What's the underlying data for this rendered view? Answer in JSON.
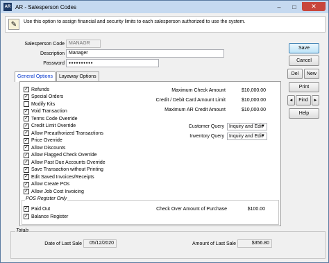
{
  "window": {
    "app_icon_text": "AR",
    "title": "AR - Salesperson Codes",
    "min": "–",
    "max": "□",
    "close": "✕"
  },
  "info": {
    "text": "Use this option to assign financial and security limits to each salesperson authorized  to use the system.",
    "icon": "info-icon"
  },
  "form": {
    "code_label": "Salesperson Code",
    "code_value": "MANAGR",
    "desc_label": "Description",
    "desc_value": "Manager",
    "pwd_label": "Password",
    "pwd_value": "●●●●●●●●●●"
  },
  "tabs": [
    "General Options",
    "Layaway Options"
  ],
  "options": [
    {
      "label": "Refunds",
      "checked": true
    },
    {
      "label": "Special Orders",
      "checked": true
    },
    {
      "label": "Modify Kits",
      "checked": false
    },
    {
      "label": "Void Transaction",
      "checked": true
    },
    {
      "label": "Terms Code Override",
      "checked": true
    },
    {
      "label": "Credit Limit Override",
      "checked": true
    },
    {
      "label": "Allow Preauthorized Transactions",
      "checked": true
    },
    {
      "label": "Price Override",
      "checked": true
    },
    {
      "label": "Allow Discounts",
      "checked": true
    },
    {
      "label": "Allow Flagged Check Override",
      "checked": true
    },
    {
      "label": "Allow Past Due Accounts Override",
      "checked": true
    },
    {
      "label": "Save Transaction without Printing",
      "checked": true
    },
    {
      "label": "Edit Saved Invoices/Receipts",
      "checked": true
    },
    {
      "label": "Allow Create POs",
      "checked": true
    },
    {
      "label": "Allow Job Cost Invoicing",
      "checked": true
    }
  ],
  "limits": [
    {
      "label": "Maximum Check Amount",
      "value": "$10,000.00"
    },
    {
      "label": "Credit / Debit Card Amount Limit",
      "value": "$10,000.00"
    },
    {
      "label": "Maximum AR Credit Amount",
      "value": "$10,000.00"
    }
  ],
  "queries": [
    {
      "label": "Customer Query",
      "value": "Inquiry and Edit"
    },
    {
      "label": "Inventory Query",
      "value": "Inquiry and Edit"
    }
  ],
  "pos": {
    "title": "POS Register Only",
    "options": [
      {
        "label": "Paid Out",
        "checked": true
      },
      {
        "label": "Balance Register",
        "checked": true
      }
    ],
    "over_label": "Check Over Amount of Purchase",
    "over_value": "$100.00"
  },
  "buttons": {
    "save": "Save",
    "cancel": "Cancel",
    "del": "Del",
    "new": "New",
    "print": "Print",
    "prev": "◄",
    "find": "Find",
    "next": "►",
    "help": "Help"
  },
  "totals": {
    "title": "Totals",
    "date_label": "Date of Last Sale",
    "date_value": "05/12/2020",
    "amount_label": "Amount of Last Sale",
    "amount_value": "$356.80"
  },
  "colors": {
    "titlebar": "#c5d9f0",
    "tab_active_text": "#0033cc",
    "close_button": "#c8463c"
  }
}
